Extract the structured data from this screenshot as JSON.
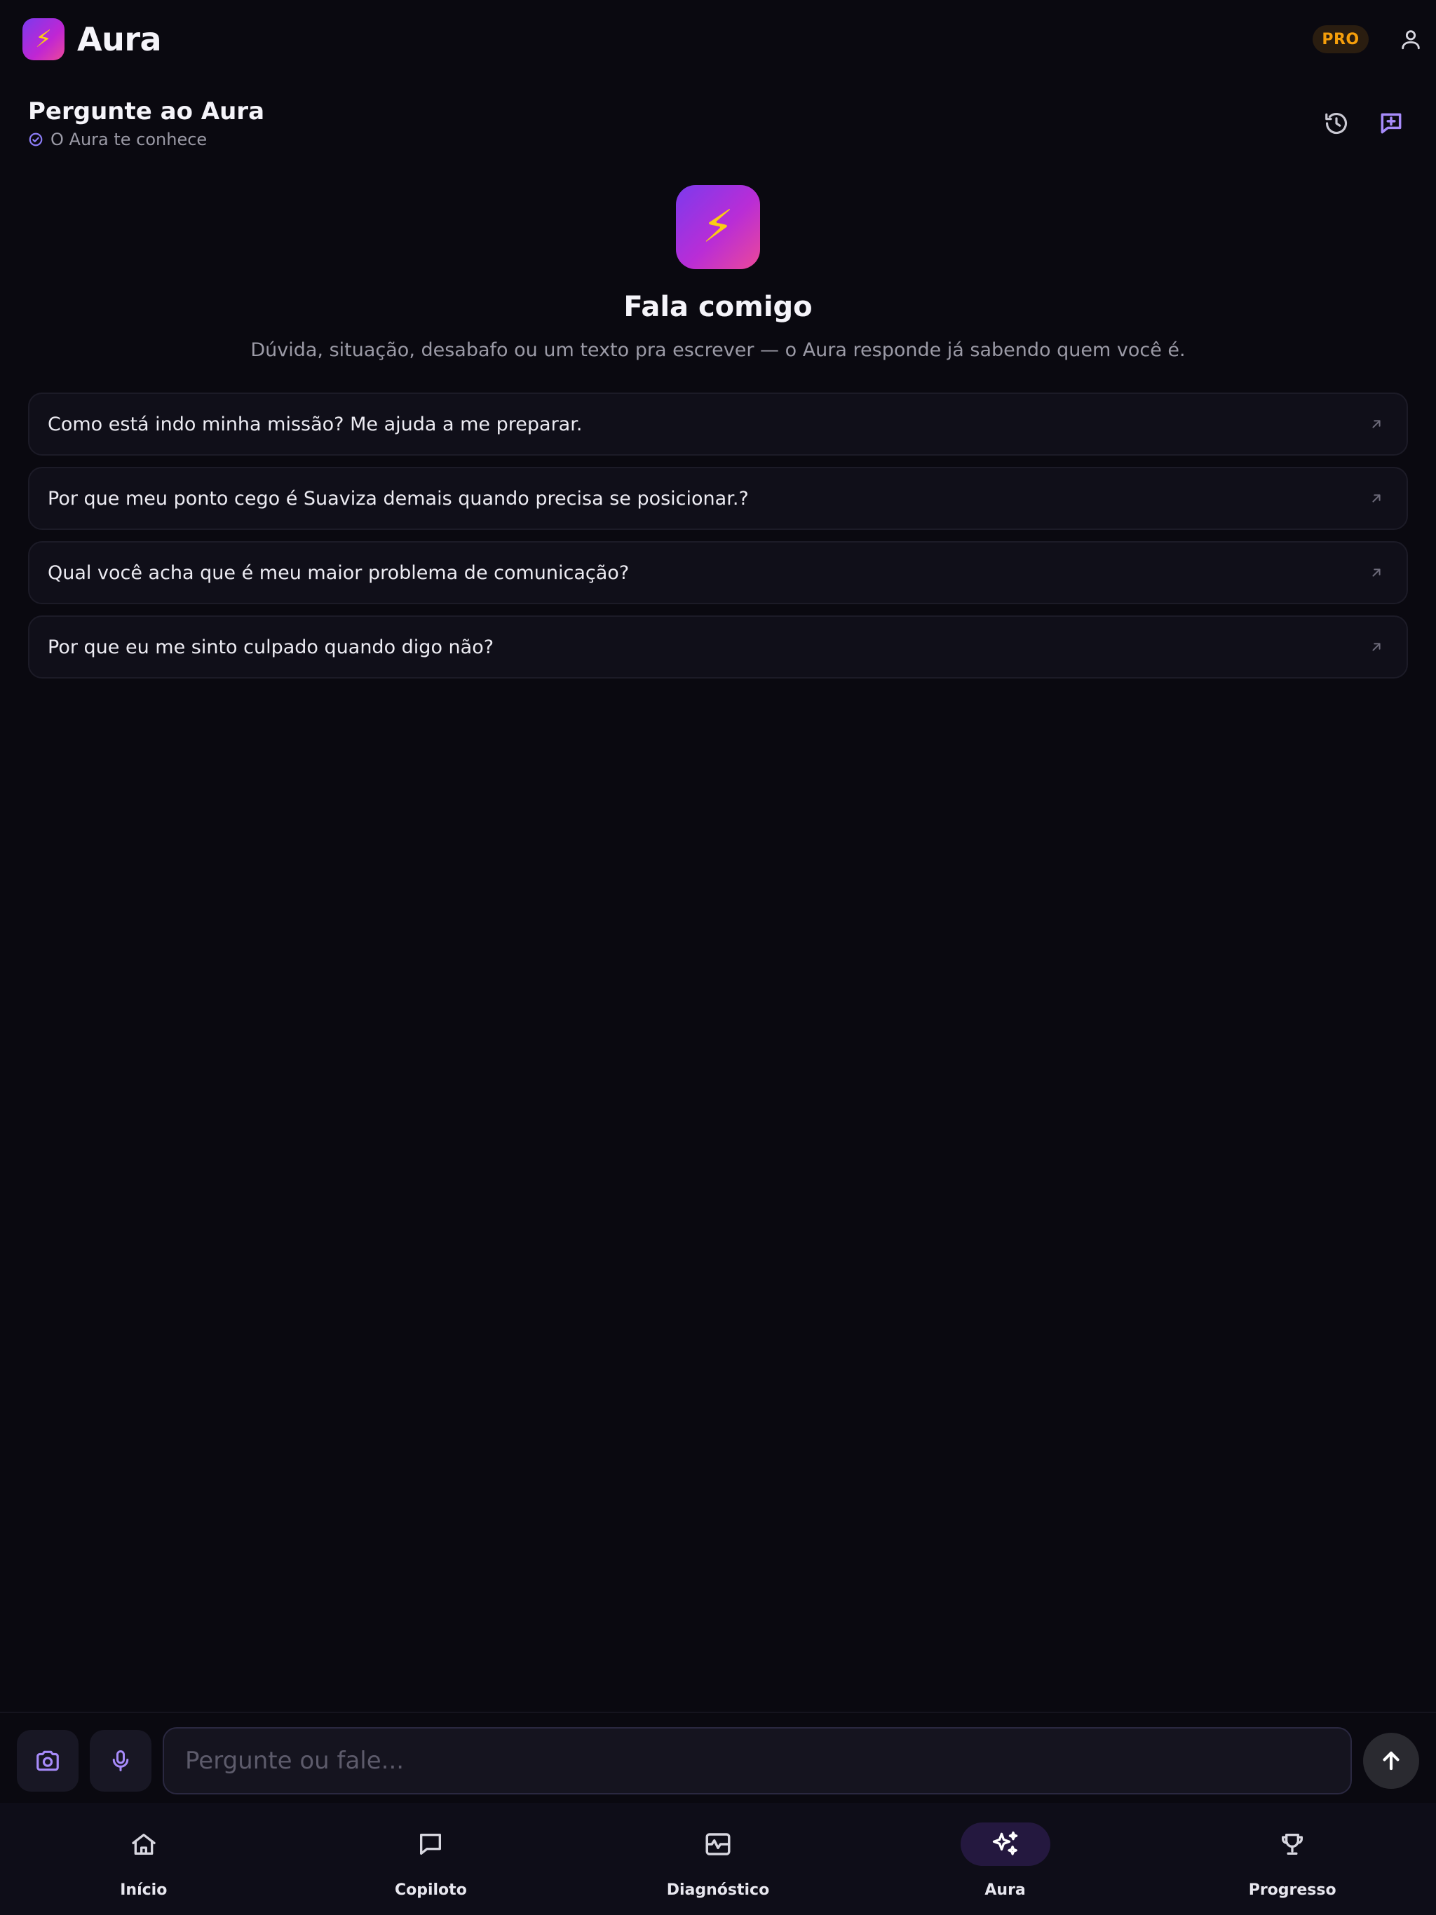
{
  "header": {
    "app_name": "Aura",
    "logo_icon": "⚡",
    "pro_badge": "PRO"
  },
  "chat": {
    "title": "Pergunte ao Aura",
    "subtitle": "O Aura te conhece"
  },
  "hero": {
    "icon": "⚡",
    "title": "Fala comigo",
    "subtitle": "Dúvida, situação, desabafo ou um texto pra escrever — o Aura responde já sabendo quem você é."
  },
  "suggestions": [
    {
      "text": "Como está indo minha missão? Me ajuda a me preparar."
    },
    {
      "text": "Por que meu ponto cego é Suaviza demais quando precisa se posicionar.?"
    },
    {
      "text": "Qual você acha que é meu maior problema de comunicação?"
    },
    {
      "text": "Por que eu me sinto culpado quando digo não?"
    }
  ],
  "composer": {
    "placeholder": "Pergunte ou fale..."
  },
  "nav": {
    "items": [
      {
        "label": "Início",
        "icon": "home-icon",
        "active": false
      },
      {
        "label": "Copiloto",
        "icon": "chat-bubble-icon",
        "active": false
      },
      {
        "label": "Diagnóstico",
        "icon": "pulse-icon",
        "active": false
      },
      {
        "label": "Aura",
        "icon": "sparkles-icon",
        "active": true
      },
      {
        "label": "Progresso",
        "icon": "trophy-icon",
        "active": false
      }
    ]
  },
  "colors": {
    "background": "#0a0910",
    "accent": "#a78bfa",
    "pro": "#f59e0b",
    "active_nav": "#24183f"
  }
}
